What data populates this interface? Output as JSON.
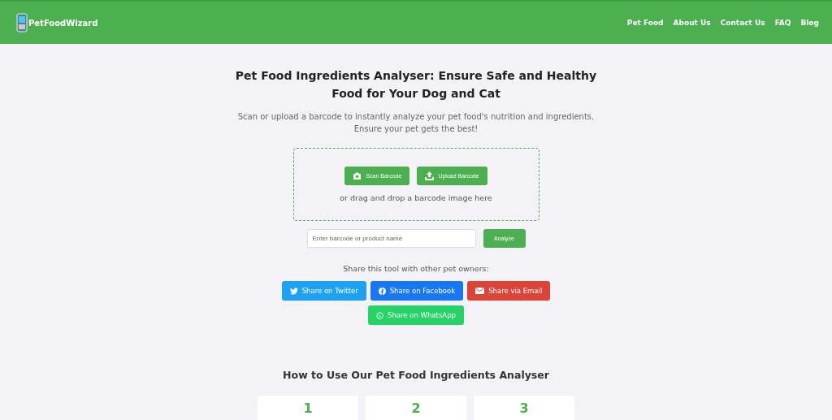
{
  "header": {
    "logo_text": "PetFoodWizard",
    "nav": [
      {
        "label": "Pet Food"
      },
      {
        "label": "About Us"
      },
      {
        "label": "Contact Us"
      },
      {
        "label": "FAQ"
      },
      {
        "label": "Blog"
      }
    ]
  },
  "hero": {
    "title": "Pet Food Ingredients Analyser: Ensure Safe and Healthy Food for Your Dog and Cat",
    "subtitle": "Scan or upload a barcode to instantly analyze your pet food's nutrition and ingredients. Ensure your pet gets the best!"
  },
  "dropzone": {
    "buttons": [
      {
        "kind": "scan",
        "label": "Scan Barcode"
      },
      {
        "kind": "upload",
        "label": "Upload Barcode"
      }
    ],
    "hint": "or drag and drop a barcode image here"
  },
  "search": {
    "placeholder": "Enter barcode or product name",
    "button": "Analyze"
  },
  "share": {
    "prompt": "Share this tool with other pet owners:",
    "buttons": [
      {
        "kind": "twitter",
        "label": "Share on Twitter"
      },
      {
        "kind": "facebook",
        "label": "Share on Facebook"
      },
      {
        "kind": "email",
        "label": "Share via Email"
      },
      {
        "kind": "whatsapp",
        "label": "Share on WhatsApp"
      }
    ]
  },
  "how_to": {
    "title": "How to Use Our Pet Food Ingredients Analyser",
    "steps": [
      {
        "number": "1"
      },
      {
        "number": "2"
      },
      {
        "number": "3"
      }
    ]
  }
}
